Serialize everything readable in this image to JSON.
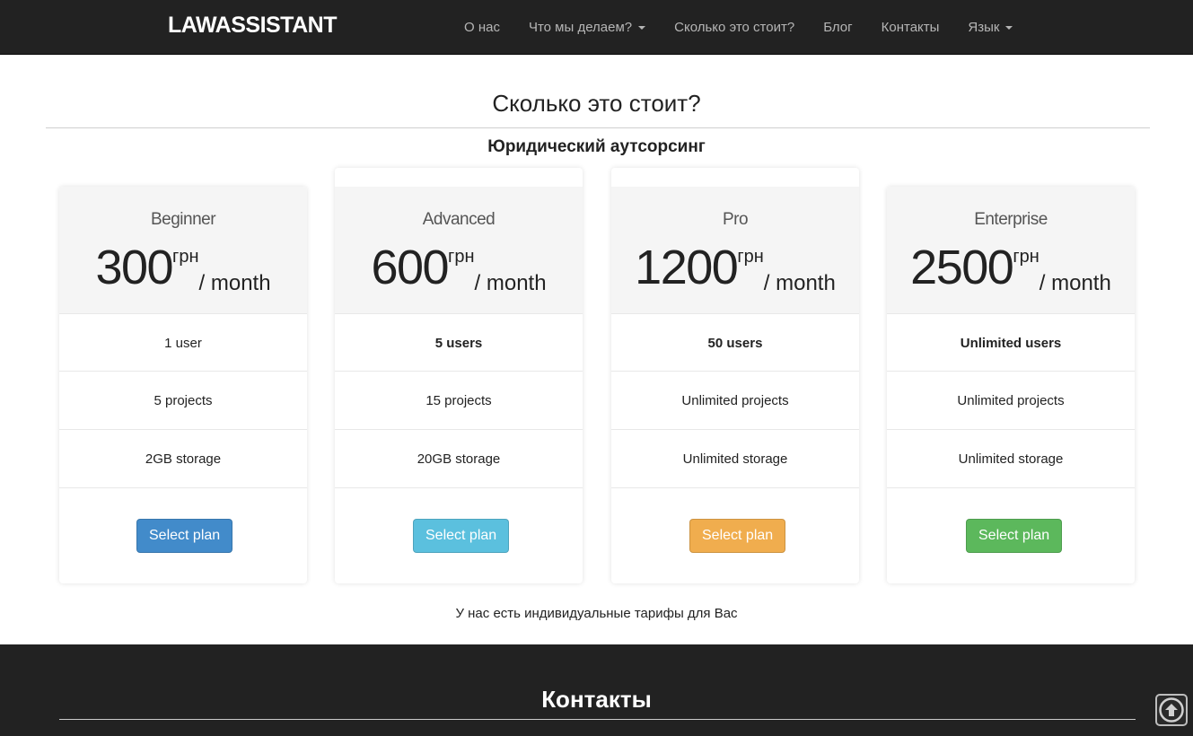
{
  "brand": "LAWASSISTANT",
  "nav": [
    {
      "label": "О нас",
      "dropdown": false
    },
    {
      "label": "Что мы делаем?",
      "dropdown": true
    },
    {
      "label": "Сколько это стоит?",
      "dropdown": false
    },
    {
      "label": "Блог",
      "dropdown": false
    },
    {
      "label": "Контакты",
      "dropdown": false
    },
    {
      "label": "Язык",
      "dropdown": true
    }
  ],
  "section": {
    "title": "Сколько это стоит?",
    "subtitle": "Юридический аутсорсинг",
    "note": "У нас есть индивидуальные тарифы для Вас"
  },
  "plans": [
    {
      "name": "Beginner",
      "price": "300",
      "currency": "грн",
      "period": "/ month",
      "features": [
        "1 user",
        "5 projects",
        "2GB storage"
      ],
      "button": "Select plan",
      "button_color": "#428bca"
    },
    {
      "name": "Advanced",
      "price": "600",
      "currency": "грн",
      "period": "/ month",
      "features": [
        "5 users",
        "15 projects",
        "20GB storage"
      ],
      "button": "Select plan",
      "button_color": "#5bc0de"
    },
    {
      "name": "Pro",
      "price": "1200",
      "currency": "грн",
      "period": "/ month",
      "features": [
        "50 users",
        "Unlimited projects",
        "Unlimited storage"
      ],
      "button": "Select plan",
      "button_color": "#f0ad4e"
    },
    {
      "name": "Enterprise",
      "price": "2500",
      "currency": "грн",
      "period": "/ month",
      "features": [
        "Unlimited users",
        "Unlimited projects",
        "Unlimited storage"
      ],
      "button": "Select plan",
      "button_color": "#5cb85c"
    }
  ],
  "footer": {
    "title": "Контакты"
  },
  "scroll_top_icon": "arrow-up-circle-icon"
}
